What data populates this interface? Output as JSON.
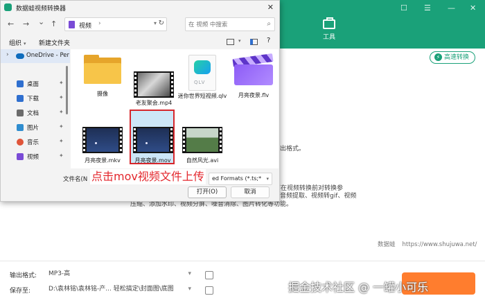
{
  "app": {
    "window_controls": [
      "☐",
      "☰",
      "—",
      "✕"
    ],
    "tool_label": "工具",
    "fast_convert_label": "高速转换",
    "fragment_top": "出格式。",
    "fragment_mid": "可在视频转换前对转换参",
    "description": "数进行自定义调整，一键高效处理，实现音视频转换、音频提取、视频转gif、视频压缩、添加水印、视频分屏、噪音消除、图片转化等功能。",
    "credit_name": "数据蛙",
    "credit_url": "https://www.shujuwa.net/",
    "output_format_label": "输出格式:",
    "output_format_value": "MP3-高",
    "save_to_label": "保存至:",
    "save_to_value": "D:\\袁林铭\\袁林铭-产...  轻松搞定\\封面图\\底图"
  },
  "dialog": {
    "title": "数据蛙视频转换器",
    "close": "✕",
    "nav": {
      "back": "←",
      "forward": "→",
      "dropdown": "⌄",
      "up": "↑"
    },
    "address_path": "视频",
    "address_sep": "›",
    "search_placeholder": "在 视频 中搜索",
    "organize_label": "组织",
    "new_folder_label": "新建文件夹",
    "sidebar": {
      "onedrive": "OneDrive - Per",
      "items": [
        {
          "label": "桌面",
          "color": "#2f6fcf"
        },
        {
          "label": "下载",
          "color": "#2f6fcf"
        },
        {
          "label": "文档",
          "color": "#6b6b6b"
        },
        {
          "label": "图片",
          "color": "#2f8dcf"
        },
        {
          "label": "音乐",
          "color": "#e0553a"
        },
        {
          "label": "视频",
          "color": "#7a4bd6"
        }
      ]
    },
    "files": [
      {
        "name": "摄像",
        "kind": "folder"
      },
      {
        "name": "老友聚会.mp4",
        "kind": "film-party"
      },
      {
        "name": "迷你世界短视频.qlv",
        "kind": "qlv",
        "ext": "QLV"
      },
      {
        "name": "月亮夜景.flv",
        "kind": "flv"
      },
      {
        "name": "月亮夜景.mkv",
        "kind": "film-night"
      },
      {
        "name": "月亮夜景.mov",
        "kind": "film-night",
        "selected": true
      },
      {
        "name": "自然风光.avi",
        "kind": "film-nature"
      }
    ],
    "filename_label": "文件名(N",
    "file_type_value": "ed Formats (*.ts;*",
    "open_button": "打开(O)",
    "cancel_button": "取消"
  },
  "annotation": "点击mov视频文件上传",
  "watermark": "掘金技术社区 @ 一罐小可乐"
}
